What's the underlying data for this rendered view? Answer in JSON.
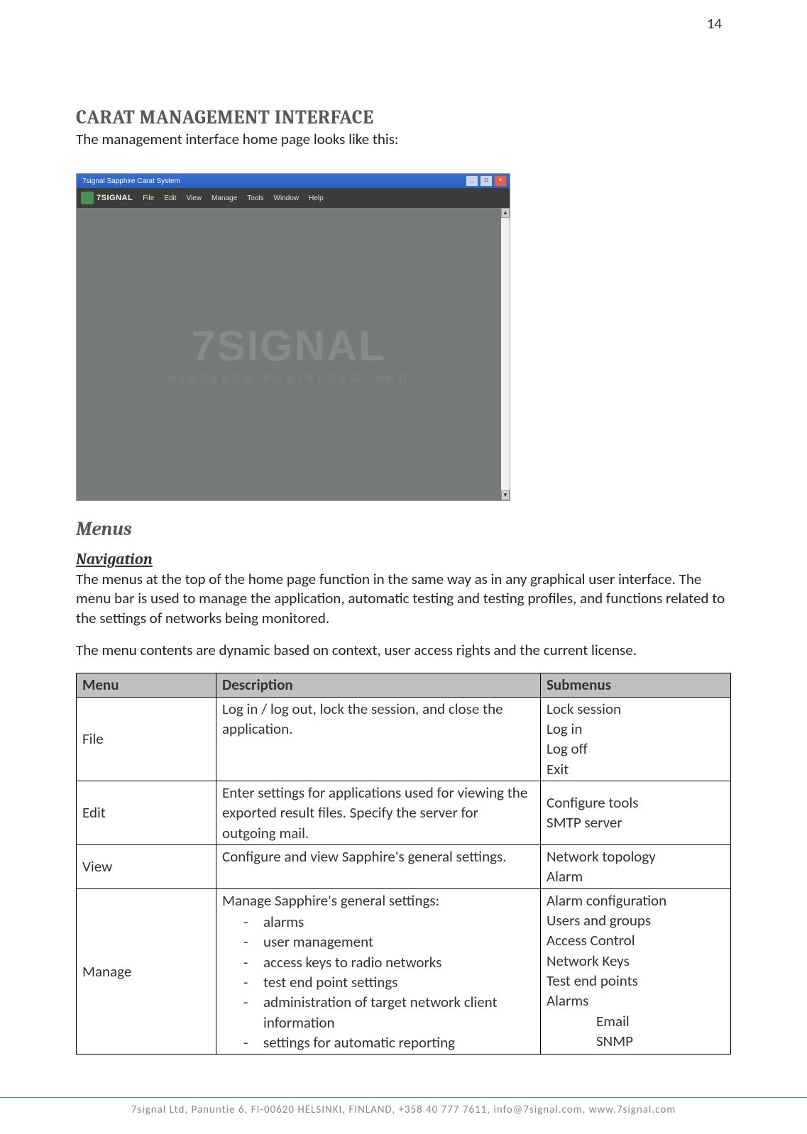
{
  "page_number": "14",
  "heading": "CARAT MANAGEMENT INTERFACE",
  "intro": "The management interface home page looks like this:",
  "screenshot": {
    "window_title": "7signal Sapphire Carat System",
    "logo_text": "7SIGNAL",
    "menus": [
      "File",
      "Edit",
      "View",
      "Manage",
      "Tools",
      "Window",
      "Help"
    ],
    "watermark_main": "7SIGNAL",
    "watermark_sub": "WIRELESS BUSINESSGUARD"
  },
  "section_heading": "Menus",
  "subsection_heading": "Navigation",
  "para1": "The menus at the top of the home page function in the same way as in any graphical user interface. The menu bar is used to manage the application, automatic testing and testing profiles, and functions related to the settings of networks being monitored.",
  "para2": "The menu contents are dynamic based on context, user access rights and the current license.",
  "table": {
    "headers": [
      "Menu",
      "Description",
      "Submenus"
    ],
    "rows": [
      {
        "menu": "File",
        "description": "Log in / log out, lock the session, and close the application.",
        "submenus": [
          "Lock session",
          "Log in",
          "Log off",
          "Exit"
        ]
      },
      {
        "menu": "Edit",
        "description": "Enter settings for applications used for viewing the exported result files. Specify the server for outgoing mail.",
        "submenus": [
          "Configure tools",
          "SMTP server"
        ]
      },
      {
        "menu": "View",
        "description": "Configure and view Sapphire's general settings.",
        "submenus": [
          "Network topology",
          "Alarm"
        ]
      },
      {
        "menu": "Manage",
        "description_intro": "Manage Sapphire's general settings:",
        "description_items": [
          "alarms",
          "user management",
          "access keys to radio networks",
          "test end point settings",
          "administration of target network client information",
          "settings for automatic reporting"
        ],
        "submenus": [
          "Alarm configuration",
          "Users and groups",
          "Access Control",
          "Network Keys",
          "Test end points",
          "Alarms"
        ],
        "submenus_indent": [
          "Email",
          "SNMP"
        ]
      }
    ]
  },
  "footer": "7signal Ltd, Panuntie 6, FI-00620 HELSINKI, FINLAND, +358 40 777 7611, info@7signal.com, www.7signal.com"
}
